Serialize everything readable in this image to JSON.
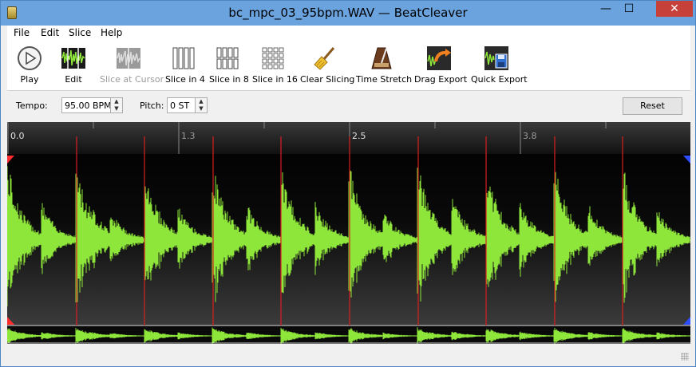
{
  "window": {
    "title": "bc_mpc_03_95bpm.WAV — BeatCleaver",
    "minimize": "—",
    "maximize": "☐",
    "close": "✕"
  },
  "menu": [
    "File",
    "Edit",
    "Slice",
    "Help"
  ],
  "toolbar": [
    {
      "label": "Play",
      "icon": "play-icon",
      "enabled": true
    },
    {
      "label": "Edit",
      "icon": "edit-waveform-icon",
      "enabled": true
    },
    {
      "label": "Slice at Cursor",
      "icon": "slice-cursor-icon",
      "enabled": false
    },
    {
      "label": "Slice in 4",
      "icon": "slice-4-icon",
      "enabled": true
    },
    {
      "label": "Slice in 8",
      "icon": "slice-8-icon",
      "enabled": true
    },
    {
      "label": "Slice in 16",
      "icon": "slice-16-icon",
      "enabled": true
    },
    {
      "label": "Clear Slicing",
      "icon": "broom-icon",
      "enabled": true
    },
    {
      "label": "Time Stretch",
      "icon": "metronome-icon",
      "enabled": true
    },
    {
      "label": "Drag Export",
      "icon": "drag-export-icon",
      "enabled": true
    },
    {
      "label": "Quick Export",
      "icon": "quick-export-icon",
      "enabled": true
    }
  ],
  "controls": {
    "tempo_label": "Tempo:",
    "tempo_value": "95.00 BPM",
    "pitch_label": "Pitch:",
    "pitch_value": "0 ST",
    "reset_label": "Reset"
  },
  "waveform": {
    "ruler_labels": [
      "0.0",
      "1.3",
      "2.5",
      "3.8"
    ],
    "duration": 5.0,
    "slice_markers": [
      0.5,
      1.0,
      1.5,
      2.0,
      2.5,
      3.0,
      3.5,
      4.0,
      4.5
    ],
    "waveform_color": "#8fe63a",
    "marker_color": "#d92020",
    "background": "#000000"
  }
}
